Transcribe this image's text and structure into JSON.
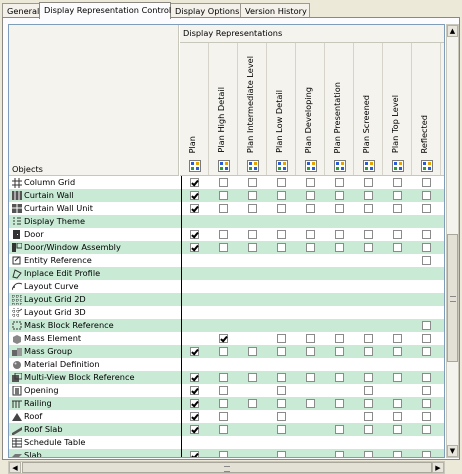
{
  "tabs": [
    {
      "label": "General",
      "active": false
    },
    {
      "label": "Display Representation Control",
      "active": true
    },
    {
      "label": "Display Options",
      "active": false
    },
    {
      "label": "Version History",
      "active": false
    }
  ],
  "grid": {
    "objects_label": "Objects",
    "group_label": "Display Representations",
    "columns": [
      "Plan",
      "Plan High Detail",
      "Plan Intermediate Level",
      "Plan Low Detail",
      "Plan Developing",
      "Plan Presentation",
      "Plan Screened",
      "Plan Top Level",
      "Reflected"
    ],
    "rows": [
      {
        "name": "Column Grid",
        "icon": "column-grid-icon",
        "cells": [
          1,
          0,
          0,
          0,
          0,
          0,
          0,
          0,
          0
        ]
      },
      {
        "name": "Curtain Wall",
        "icon": "curtain-wall-icon",
        "cells": [
          1,
          0,
          0,
          0,
          0,
          0,
          0,
          0,
          0
        ]
      },
      {
        "name": "Curtain Wall Unit",
        "icon": "curtain-wall-unit-icon",
        "cells": [
          1,
          0,
          0,
          0,
          0,
          0,
          0,
          0,
          0
        ]
      },
      {
        "name": "Display Theme",
        "icon": "display-theme-icon",
        "cells": [
          null,
          null,
          null,
          null,
          null,
          null,
          null,
          null,
          null
        ]
      },
      {
        "name": "Door",
        "icon": "door-icon",
        "cells": [
          1,
          0,
          0,
          0,
          0,
          0,
          0,
          0,
          0
        ]
      },
      {
        "name": "Door/Window Assembly",
        "icon": "door-window-assembly-icon",
        "cells": [
          1,
          0,
          0,
          0,
          0,
          0,
          0,
          0,
          0
        ]
      },
      {
        "name": "Entity Reference",
        "icon": "entity-reference-icon",
        "cells": [
          null,
          null,
          null,
          null,
          null,
          null,
          null,
          null,
          0
        ]
      },
      {
        "name": "Inplace Edit Profile",
        "icon": "inplace-edit-profile-icon",
        "cells": [
          null,
          null,
          null,
          null,
          null,
          null,
          null,
          null,
          null
        ]
      },
      {
        "name": "Layout Curve",
        "icon": "layout-curve-icon",
        "cells": [
          null,
          null,
          null,
          null,
          null,
          null,
          null,
          null,
          null
        ]
      },
      {
        "name": "Layout Grid 2D",
        "icon": "layout-grid-2d-icon",
        "cells": [
          null,
          null,
          null,
          null,
          null,
          null,
          null,
          null,
          null
        ]
      },
      {
        "name": "Layout Grid 3D",
        "icon": "layout-grid-3d-icon",
        "cells": [
          null,
          null,
          null,
          null,
          null,
          null,
          null,
          null,
          null
        ]
      },
      {
        "name": "Mask Block Reference",
        "icon": "mask-block-reference-icon",
        "cells": [
          null,
          null,
          null,
          null,
          null,
          null,
          null,
          null,
          0
        ]
      },
      {
        "name": "Mass Element",
        "icon": "mass-element-icon",
        "cells": [
          null,
          1,
          null,
          0,
          0,
          0,
          0,
          0,
          0
        ]
      },
      {
        "name": "Mass Group",
        "icon": "mass-group-icon",
        "cells": [
          1,
          0,
          0,
          0,
          0,
          0,
          0,
          0,
          0
        ]
      },
      {
        "name": "Material Definition",
        "icon": "material-definition-icon",
        "cells": [
          null,
          null,
          null,
          null,
          null,
          null,
          null,
          null,
          null
        ]
      },
      {
        "name": "Multi-View Block Reference",
        "icon": "multi-view-block-reference-icon",
        "cells": [
          1,
          0,
          0,
          0,
          0,
          0,
          0,
          0,
          0
        ]
      },
      {
        "name": "Opening",
        "icon": "opening-icon",
        "cells": [
          1,
          0,
          null,
          0,
          null,
          null,
          0,
          null,
          0
        ]
      },
      {
        "name": "Railing",
        "icon": "railing-icon",
        "cells": [
          1,
          0,
          0,
          0,
          0,
          0,
          0,
          0,
          0
        ]
      },
      {
        "name": "Roof",
        "icon": "roof-icon",
        "cells": [
          1,
          0,
          null,
          0,
          null,
          null,
          0,
          0,
          0
        ]
      },
      {
        "name": "Roof Slab",
        "icon": "roof-slab-icon",
        "cells": [
          1,
          0,
          null,
          0,
          null,
          0,
          0,
          0,
          0
        ]
      },
      {
        "name": "Schedule Table",
        "icon": "schedule-table-icon",
        "cells": [
          null,
          null,
          null,
          null,
          null,
          null,
          null,
          null,
          null
        ]
      },
      {
        "name": "Slab",
        "icon": "slab-icon",
        "cells": [
          1,
          0,
          null,
          0,
          null,
          0,
          0,
          0,
          0
        ]
      }
    ]
  },
  "scroll_arrows": {
    "up": "▲",
    "down": "▼",
    "left": "◀",
    "right": "▶"
  }
}
